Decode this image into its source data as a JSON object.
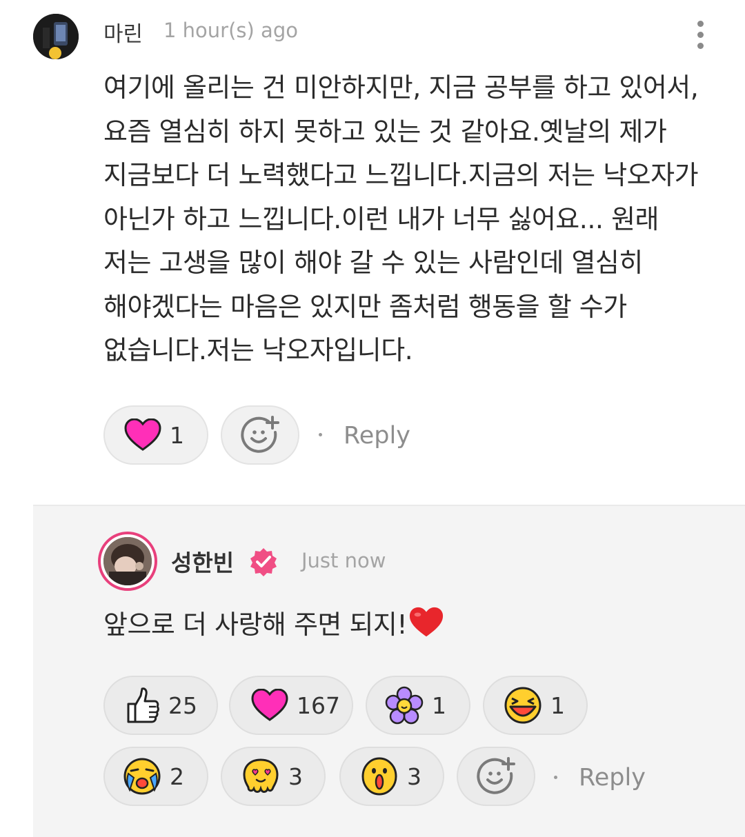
{
  "comment": {
    "author": "마린",
    "time": "1 hour(s) ago",
    "body": "여기에 올리는 건 미안하지만, 지금 공부를 하고 있어서, 요즘 열심히 하지 못하고 있는 것 같아요.옛날의 제가 지금보다 더 노력했다고 느낍니다.지금의 저는 낙오자가 아닌가 하고 느낍니다.이런 내가 너무 싫어요... 원래 저는 고생을 많이 해야 갈 수 있는 사람인데 열심히 해야겠다는 마음은 있지만 좀처럼 행동을 할 수가 없습니다.저는 낙오자입니다.",
    "reactions": [
      {
        "icon": "heart-icon",
        "count": "1"
      }
    ],
    "reply_label": "Reply"
  },
  "reply": {
    "author": "성한빈",
    "verified": true,
    "time": "Just now",
    "body": "앞으로 더 사랑해 주면 되지!",
    "body_emoji": "red-heart-icon",
    "reactions": [
      {
        "icon": "thumbs-up-icon",
        "count": "25"
      },
      {
        "icon": "heart-icon",
        "count": "167"
      },
      {
        "icon": "flower-icon",
        "count": "1"
      },
      {
        "icon": "laughing-face-icon",
        "count": "1"
      },
      {
        "icon": "crying-face-icon",
        "count": "2"
      },
      {
        "icon": "heart-eyes-face-icon",
        "count": "3"
      },
      {
        "icon": "surprised-face-icon",
        "count": "3"
      }
    ],
    "reply_label": "Reply"
  },
  "colors": {
    "heart": "#ff2fb8",
    "accent": "#e8407c",
    "muted": "#a4a4a4"
  }
}
